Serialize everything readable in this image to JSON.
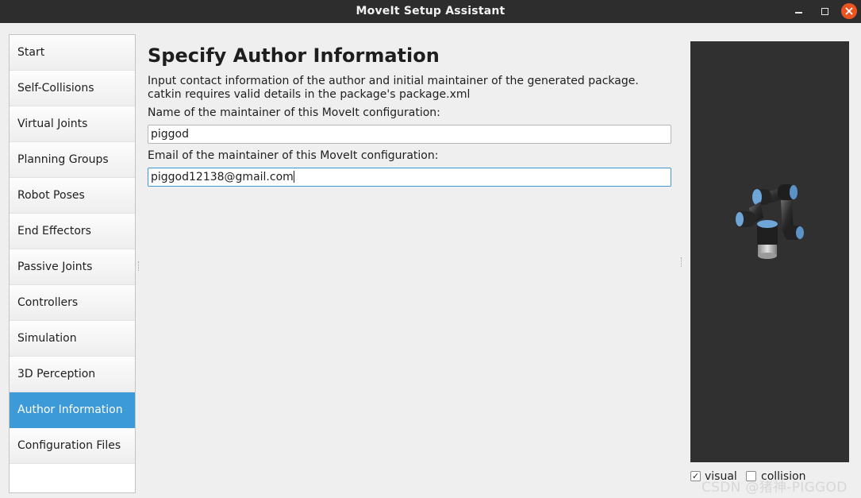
{
  "window": {
    "title": "MoveIt Setup Assistant"
  },
  "sidebar": {
    "items": [
      {
        "label": "Start"
      },
      {
        "label": "Self-Collisions"
      },
      {
        "label": "Virtual Joints"
      },
      {
        "label": "Planning Groups"
      },
      {
        "label": "Robot Poses"
      },
      {
        "label": "End Effectors"
      },
      {
        "label": "Passive Joints"
      },
      {
        "label": "Controllers"
      },
      {
        "label": "Simulation"
      },
      {
        "label": "3D Perception"
      },
      {
        "label": "Author Information"
      },
      {
        "label": "Configuration Files"
      }
    ],
    "active_index": 10
  },
  "main": {
    "title": "Specify Author Information",
    "description": "Input contact information of the author and initial maintainer of the generated package. catkin requires valid details in the package's package.xml",
    "name_label": "Name of the maintainer of this MoveIt configuration:",
    "name_value": "piggod",
    "email_label": "Email of the maintainer of this MoveIt configuration:",
    "email_value": "piggod12138@gmail.com"
  },
  "viewport": {
    "visual_label": "visual",
    "visual_checked": true,
    "collision_label": "collision",
    "collision_checked": false
  },
  "watermark": "CSDN @猪神-PIGGOD",
  "colors": {
    "accent": "#3d9ad8",
    "titlebar": "#2d2d2d",
    "close_button": "#e95420",
    "viewport_bg": "#303030"
  }
}
